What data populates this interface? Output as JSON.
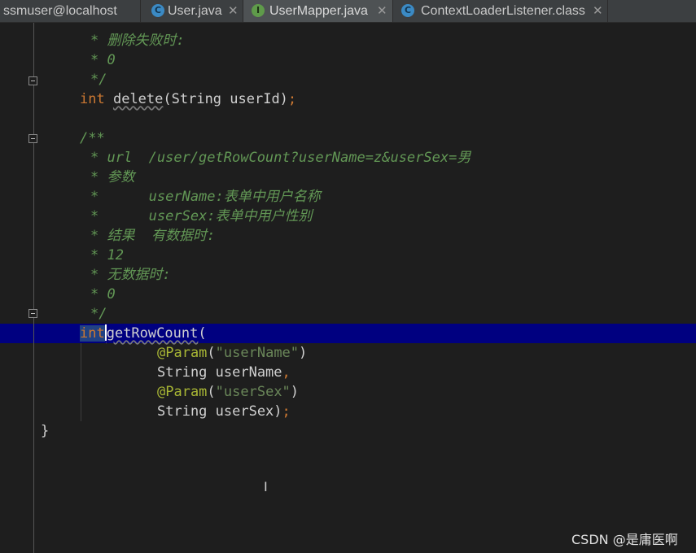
{
  "tabs": [
    {
      "label": "ssmuser@localhost",
      "badge": "",
      "active": false
    },
    {
      "label": "User.java",
      "badge": "C",
      "active": false
    },
    {
      "label": "UserMapper.java",
      "badge": "I",
      "active": true
    },
    {
      "label": "ContextLoaderListener.class",
      "badge": "C",
      "active": false
    }
  ],
  "close_glyph": "✕",
  "code": {
    "l1": "* 删除失败时:",
    "l2": "* 0",
    "l3": "*/",
    "delete_type": "int",
    "delete_name": "delete",
    "delete_params": "(String userId)",
    "delete_semi": ";",
    "l5": "/**",
    "l6": "* url  /user/getRowCount?userName=z&userSex=男",
    "l7": "* 参数",
    "l8": "*      userName:表单中用户名称",
    "l9": "*      userSex:表单中用户性别",
    "l10": "* 结果  有数据时:",
    "l11": "* 12",
    "l12": "* 无数据时:",
    "l13": "* 0",
    "l14": "*/",
    "grc_type": "int",
    "grc_name": "getRowCount",
    "grc_paren": "(",
    "ann1": "@Param",
    "ann1_open": "(",
    "ann1_str": "\"userName\"",
    "ann1_close": ")",
    "p1": "String userName",
    "p1_comma": ",",
    "ann2": "@Param",
    "ann2_open": "(",
    "ann2_str": "\"userSex\"",
    "ann2_close": ")",
    "p2": "String userSex)",
    "p2_semi": ";",
    "brace": "}"
  },
  "watermark": "CSDN @是庸医啊",
  "colors": {
    "background": "#1e1e1e",
    "comment": "#629755",
    "keyword": "#cc7832",
    "string": "#6a8759",
    "annotation": "#a9b735",
    "current_line": "#000080",
    "selection": "#214283"
  }
}
